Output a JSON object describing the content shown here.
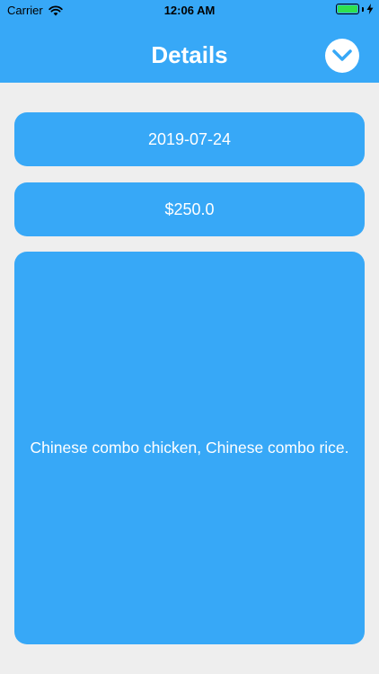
{
  "colors": {
    "accent": "#37a8f7",
    "background": "#eeeeee",
    "text": "#ffffff"
  },
  "status_bar": {
    "carrier": "Carrier",
    "time": "12:06 AM",
    "icons": [
      "wifi-icon",
      "battery-icon",
      "charging-icon"
    ]
  },
  "header": {
    "title": "Details",
    "done_icon": "chevron-down-icon"
  },
  "details": {
    "date": "2019-07-24",
    "amount": "$250.0",
    "description": "Chinese combo chicken, Chinese combo rice."
  }
}
